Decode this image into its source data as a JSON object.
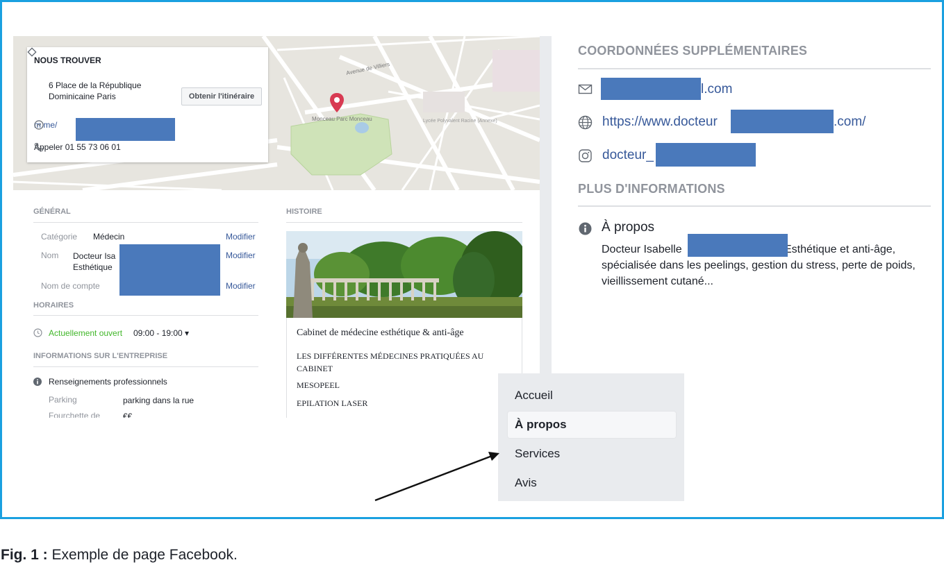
{
  "find_us": {
    "title": "NOUS TROUVER",
    "address": "6 Place de la République Dominicaine Paris",
    "itinerary_button": "Obtenir l'itinéraire",
    "messenger": "m.me/",
    "call": "Appeler 01 55 73 06 01"
  },
  "map_labels": {
    "park": "Monceau Parc Monceau",
    "street_villiers": "Avenue de Villiers",
    "lycee": "Lycée Polyvalent Racine (Annexe)"
  },
  "general": {
    "title": "GÉNÉRAL",
    "modify": "Modifier",
    "rows": [
      {
        "label": "Catégorie",
        "value": "Médecin"
      },
      {
        "label": "Nom",
        "value": "Docteur Isa",
        "value2": "Esthétique"
      },
      {
        "label": "Nom de compte",
        "value": ""
      }
    ]
  },
  "hours": {
    "title": "HORAIRES",
    "status": "Actuellement ouvert",
    "range": "09:00 - 19:00 ▾"
  },
  "business": {
    "title": "INFORMATIONS SUR L'ENTREPRISE",
    "pro_info": "Renseignements professionnels",
    "parking_label": "Parking",
    "parking_value": "parking dans la rue",
    "price_label": "Fourchette de",
    "price_value": "€€"
  },
  "history": {
    "title": "HISTOIRE",
    "heading": "Cabinet de médecine esthétique & anti-âge",
    "line1": "LES DIFFÉRENTES MÉDECINES PRATIQUÉES AU CABINET",
    "line2": "MESOPEEL",
    "line3": "EPILATION LASER"
  },
  "contact": {
    "title": "COORDONNÉES SUPPLÉMENTAIRES",
    "email_suffix": "l.com",
    "website_prefix": "https://www.docteur",
    "website_suffix": ".com/",
    "instagram": "docteur_"
  },
  "more_info": {
    "title": "PLUS D'INFORMATIONS",
    "about_title": "À propos",
    "about_text_1": "Docteur Isabelle",
    "about_text_2": "n Esthétique et anti-âge, spécialisée dans les peelings, gestion du stress, perte de poids, vieillissement cutané..."
  },
  "nav_menu": {
    "items": [
      "Accueil",
      "À propos",
      "Services",
      "Avis"
    ],
    "active_index": 1
  },
  "caption": {
    "label": "Fig. 1 :",
    "text": " Exemple de page Facebook."
  },
  "colors": {
    "frame_border": "#1aa0e0",
    "redaction": "#4a79bb",
    "link": "#365899",
    "open_green": "#42b72a",
    "map_pin": "#d83a52"
  },
  "icons": [
    "location-diamond-icon",
    "messenger-icon",
    "phone-icon",
    "clock-icon",
    "info-icon",
    "envelope-icon",
    "globe-icon",
    "instagram-icon",
    "map-pin-icon"
  ]
}
